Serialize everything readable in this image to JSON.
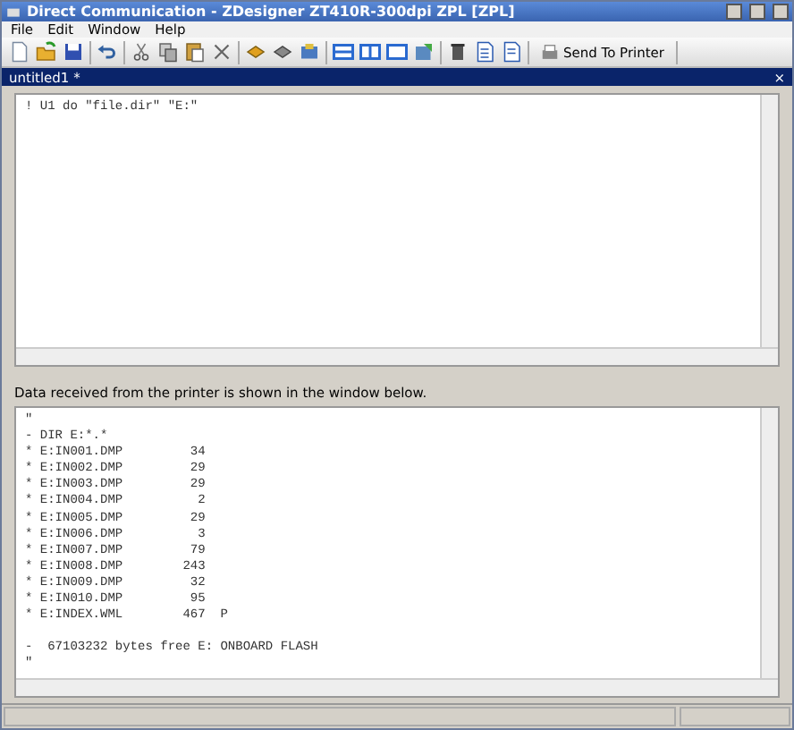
{
  "window": {
    "title": "Direct Communication - ZDesigner ZT410R-300dpi ZPL [ZPL]"
  },
  "menu": [
    "File",
    "Edit",
    "Window",
    "Help"
  ],
  "toolbar": {
    "send_button": "Send To Printer"
  },
  "document_tab": {
    "title": "untitled1 *",
    "close": "×"
  },
  "editor": {
    "lines": [
      "! U1 do \"file.dir\" \"E:\""
    ]
  },
  "output_label": "Data received from the printer is shown in the window below.",
  "output": {
    "lines": [
      "\"",
      "- DIR E:*.*",
      "* E:IN001.DMP         34",
      "* E:IN002.DMP         29",
      "* E:IN003.DMP         29",
      "* E:IN004.DMP          2",
      "* E:IN005.DMP         29",
      "* E:IN006.DMP          3",
      "* E:IN007.DMP         79",
      "* E:IN008.DMP        243",
      "* E:IN009.DMP         32",
      "* E:IN010.DMP         95",
      "* E:INDEX.WML        467  P"
    ],
    "summary": [
      "-  67103232 bytes free E: ONBOARD FLASH",
      "\""
    ]
  }
}
